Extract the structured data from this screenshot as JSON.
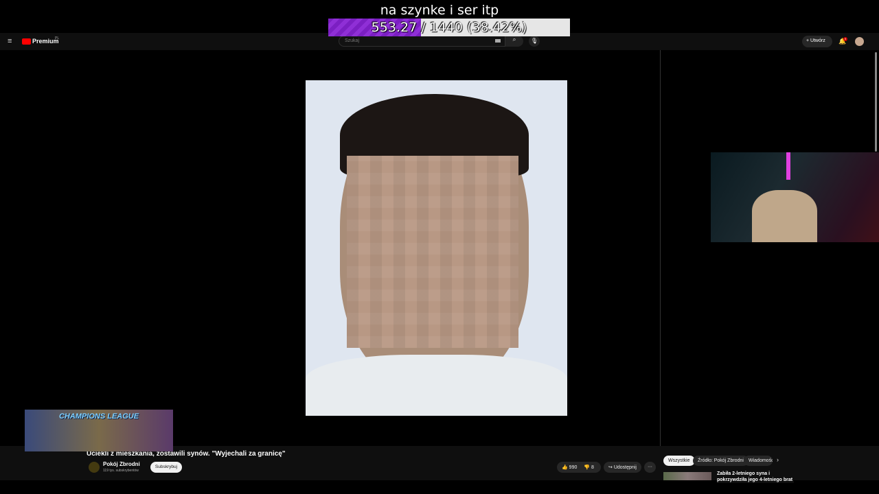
{
  "overlay": {
    "goal_title": "na szynke i ser itp",
    "goal_current": "553.27",
    "goal_rest": " / 1440 (38.42%)",
    "goal_percent": 38.42,
    "colors": {
      "fill": "#7b1fc2"
    }
  },
  "header": {
    "brand": "Premium",
    "brand_sup": "PL",
    "search_placeholder": "Szukaj",
    "create_label": "Utwórz",
    "notification_count": "9"
  },
  "overlay_game": {
    "label": "CHAMPIONS LEAGUE"
  },
  "video": {
    "title": "Uciekli z mieszkania, zostawili synów. \"Wyjechali za granicę\"",
    "channel": "Pokój Zbrodni",
    "subscribers": "119 tys. subskrybentów",
    "subscribe_label": "Subskrybuj",
    "likes": "990",
    "dislikes": "8",
    "share_label": "Udostępnij"
  },
  "related": {
    "chips": [
      "Wszystkie",
      "Źródło: Pokój Zbrodni",
      "Wiadomości"
    ],
    "first_item_title": "Zabiła 2-letniego syna i",
    "first_item_title_2": "pokrzywdziła jego 4-letniego brat"
  }
}
